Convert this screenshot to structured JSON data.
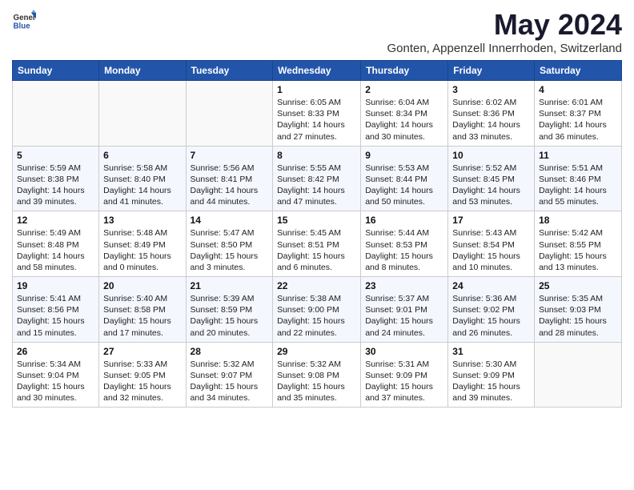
{
  "header": {
    "logo_general": "General",
    "logo_blue": "Blue",
    "title": "May 2024",
    "subtitle": "Gonten, Appenzell Innerrhoden, Switzerland"
  },
  "weekdays": [
    "Sunday",
    "Monday",
    "Tuesday",
    "Wednesday",
    "Thursday",
    "Friday",
    "Saturday"
  ],
  "weeks": [
    [
      {
        "day": "",
        "info": ""
      },
      {
        "day": "",
        "info": ""
      },
      {
        "day": "",
        "info": ""
      },
      {
        "day": "1",
        "info": "Sunrise: 6:05 AM\nSunset: 8:33 PM\nDaylight: 14 hours\nand 27 minutes."
      },
      {
        "day": "2",
        "info": "Sunrise: 6:04 AM\nSunset: 8:34 PM\nDaylight: 14 hours\nand 30 minutes."
      },
      {
        "day": "3",
        "info": "Sunrise: 6:02 AM\nSunset: 8:36 PM\nDaylight: 14 hours\nand 33 minutes."
      },
      {
        "day": "4",
        "info": "Sunrise: 6:01 AM\nSunset: 8:37 PM\nDaylight: 14 hours\nand 36 minutes."
      }
    ],
    [
      {
        "day": "5",
        "info": "Sunrise: 5:59 AM\nSunset: 8:38 PM\nDaylight: 14 hours\nand 39 minutes."
      },
      {
        "day": "6",
        "info": "Sunrise: 5:58 AM\nSunset: 8:40 PM\nDaylight: 14 hours\nand 41 minutes."
      },
      {
        "day": "7",
        "info": "Sunrise: 5:56 AM\nSunset: 8:41 PM\nDaylight: 14 hours\nand 44 minutes."
      },
      {
        "day": "8",
        "info": "Sunrise: 5:55 AM\nSunset: 8:42 PM\nDaylight: 14 hours\nand 47 minutes."
      },
      {
        "day": "9",
        "info": "Sunrise: 5:53 AM\nSunset: 8:44 PM\nDaylight: 14 hours\nand 50 minutes."
      },
      {
        "day": "10",
        "info": "Sunrise: 5:52 AM\nSunset: 8:45 PM\nDaylight: 14 hours\nand 53 minutes."
      },
      {
        "day": "11",
        "info": "Sunrise: 5:51 AM\nSunset: 8:46 PM\nDaylight: 14 hours\nand 55 minutes."
      }
    ],
    [
      {
        "day": "12",
        "info": "Sunrise: 5:49 AM\nSunset: 8:48 PM\nDaylight: 14 hours\nand 58 minutes."
      },
      {
        "day": "13",
        "info": "Sunrise: 5:48 AM\nSunset: 8:49 PM\nDaylight: 15 hours\nand 0 minutes."
      },
      {
        "day": "14",
        "info": "Sunrise: 5:47 AM\nSunset: 8:50 PM\nDaylight: 15 hours\nand 3 minutes."
      },
      {
        "day": "15",
        "info": "Sunrise: 5:45 AM\nSunset: 8:51 PM\nDaylight: 15 hours\nand 6 minutes."
      },
      {
        "day": "16",
        "info": "Sunrise: 5:44 AM\nSunset: 8:53 PM\nDaylight: 15 hours\nand 8 minutes."
      },
      {
        "day": "17",
        "info": "Sunrise: 5:43 AM\nSunset: 8:54 PM\nDaylight: 15 hours\nand 10 minutes."
      },
      {
        "day": "18",
        "info": "Sunrise: 5:42 AM\nSunset: 8:55 PM\nDaylight: 15 hours\nand 13 minutes."
      }
    ],
    [
      {
        "day": "19",
        "info": "Sunrise: 5:41 AM\nSunset: 8:56 PM\nDaylight: 15 hours\nand 15 minutes."
      },
      {
        "day": "20",
        "info": "Sunrise: 5:40 AM\nSunset: 8:58 PM\nDaylight: 15 hours\nand 17 minutes."
      },
      {
        "day": "21",
        "info": "Sunrise: 5:39 AM\nSunset: 8:59 PM\nDaylight: 15 hours\nand 20 minutes."
      },
      {
        "day": "22",
        "info": "Sunrise: 5:38 AM\nSunset: 9:00 PM\nDaylight: 15 hours\nand 22 minutes."
      },
      {
        "day": "23",
        "info": "Sunrise: 5:37 AM\nSunset: 9:01 PM\nDaylight: 15 hours\nand 24 minutes."
      },
      {
        "day": "24",
        "info": "Sunrise: 5:36 AM\nSunset: 9:02 PM\nDaylight: 15 hours\nand 26 minutes."
      },
      {
        "day": "25",
        "info": "Sunrise: 5:35 AM\nSunset: 9:03 PM\nDaylight: 15 hours\nand 28 minutes."
      }
    ],
    [
      {
        "day": "26",
        "info": "Sunrise: 5:34 AM\nSunset: 9:04 PM\nDaylight: 15 hours\nand 30 minutes."
      },
      {
        "day": "27",
        "info": "Sunrise: 5:33 AM\nSunset: 9:05 PM\nDaylight: 15 hours\nand 32 minutes."
      },
      {
        "day": "28",
        "info": "Sunrise: 5:32 AM\nSunset: 9:07 PM\nDaylight: 15 hours\nand 34 minutes."
      },
      {
        "day": "29",
        "info": "Sunrise: 5:32 AM\nSunset: 9:08 PM\nDaylight: 15 hours\nand 35 minutes."
      },
      {
        "day": "30",
        "info": "Sunrise: 5:31 AM\nSunset: 9:09 PM\nDaylight: 15 hours\nand 37 minutes."
      },
      {
        "day": "31",
        "info": "Sunrise: 5:30 AM\nSunset: 9:09 PM\nDaylight: 15 hours\nand 39 minutes."
      },
      {
        "day": "",
        "info": ""
      }
    ]
  ]
}
